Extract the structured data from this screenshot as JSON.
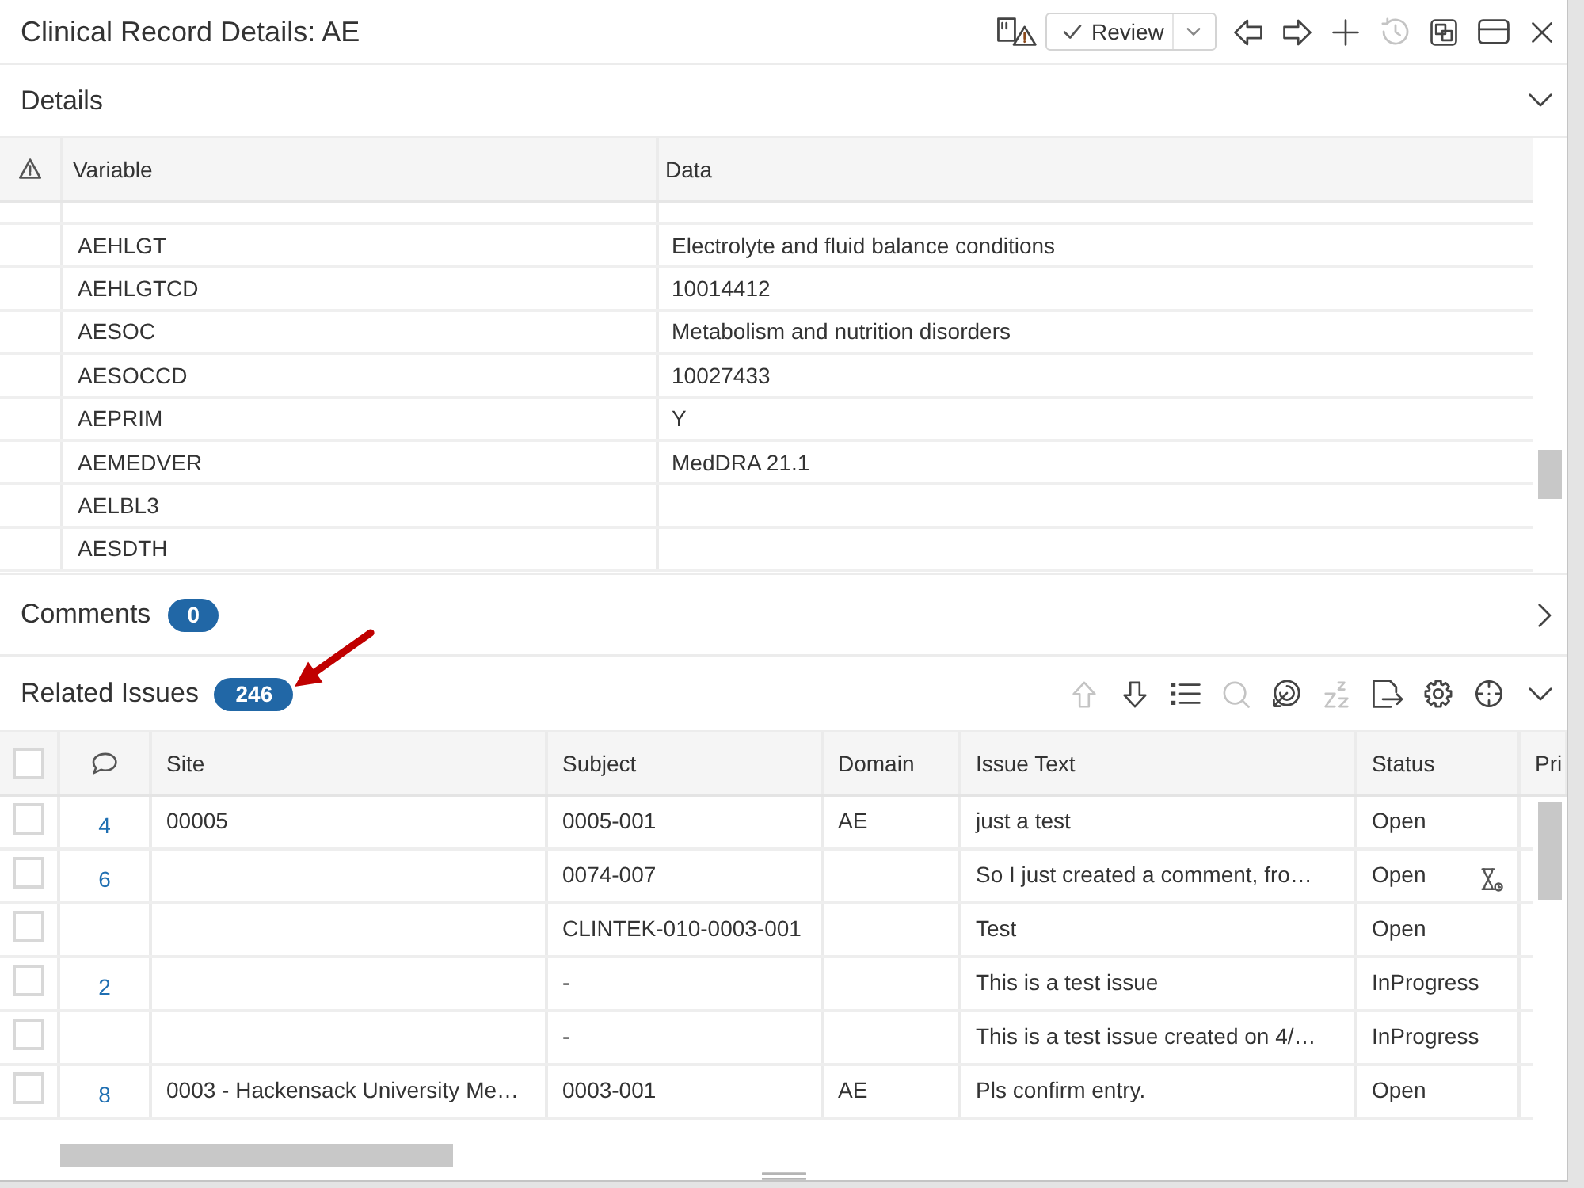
{
  "window": {
    "title": "Clinical Record Details: AE"
  },
  "toolbar": [
    {
      "kind": "note-alert",
      "disabled": false
    },
    {
      "kind": "review",
      "label": "Review"
    },
    {
      "kind": "back",
      "disabled": false
    },
    {
      "kind": "forward",
      "disabled": false
    },
    {
      "kind": "add",
      "disabled": false
    },
    {
      "kind": "history",
      "disabled": true
    },
    {
      "kind": "layout",
      "disabled": false
    },
    {
      "kind": "window",
      "disabled": false
    },
    {
      "kind": "close",
      "disabled": false
    }
  ],
  "details": {
    "title": "Details",
    "expanded": true,
    "columns": [
      "Variable",
      "Data"
    ],
    "rows": [
      {
        "variable": "AEHLGT",
        "data": "Electrolyte and fluid balance conditions"
      },
      {
        "variable": "AEHLGTCD",
        "data": "10014412"
      },
      {
        "variable": "AESOC",
        "data": "Metabolism and nutrition disorders"
      },
      {
        "variable": "AESOCCD",
        "data": "10027433"
      },
      {
        "variable": "AEPRIM",
        "data": "Y"
      },
      {
        "variable": "AEMEDVER",
        "data": "MedDRA 21.1"
      },
      {
        "variable": "AELBL3"
      },
      {
        "variable": "AESDTH"
      }
    ]
  },
  "comments": {
    "title": "Comments",
    "count": "0",
    "expanded": false
  },
  "related_issues": {
    "title": "Related Issues",
    "count": "246",
    "expanded": true,
    "toolbar": [
      {
        "kind": "move-up",
        "disabled": true
      },
      {
        "kind": "move-down",
        "disabled": false
      },
      {
        "kind": "list",
        "disabled": false
      },
      {
        "kind": "search",
        "disabled": true
      },
      {
        "kind": "target",
        "disabled": false
      },
      {
        "kind": "snooze",
        "disabled": true
      },
      {
        "kind": "export",
        "disabled": false
      },
      {
        "kind": "settings",
        "disabled": false
      },
      {
        "kind": "crosshair",
        "disabled": false
      }
    ],
    "select_all_checked": false,
    "columns": [
      "Site",
      "Subject",
      "Domain",
      "Issue Text",
      "Status",
      "Pri"
    ],
    "rows": [
      {
        "checked": false,
        "comments": "4",
        "site": "00005",
        "subject": "0005-001",
        "domain": "AE",
        "issue_text": "just a test",
        "status": "Open",
        "pending": false
      },
      {
        "checked": false,
        "comments": "6",
        "subject": "0074-007",
        "issue_text": "So I just created a comment, fro…",
        "status": "Open",
        "pending": true
      },
      {
        "checked": false,
        "subject": "CLINTEK-010-0003-001",
        "issue_text": "Test",
        "status": "Open",
        "pending": false
      },
      {
        "checked": false,
        "comments": "2",
        "subject": "-",
        "issue_text": "This is a test issue",
        "status": "InProgress",
        "pending": false
      },
      {
        "checked": false,
        "subject": "-",
        "issue_text": "This is a test issue created on 4/…",
        "status": "InProgress",
        "pending": false
      },
      {
        "checked": false,
        "comments": "8",
        "site": "0003 - Hackensack University Me…",
        "subject": "0003-001",
        "domain": "AE",
        "issue_text": "Pls confirm entry.",
        "status": "Open",
        "pending": false
      }
    ]
  }
}
